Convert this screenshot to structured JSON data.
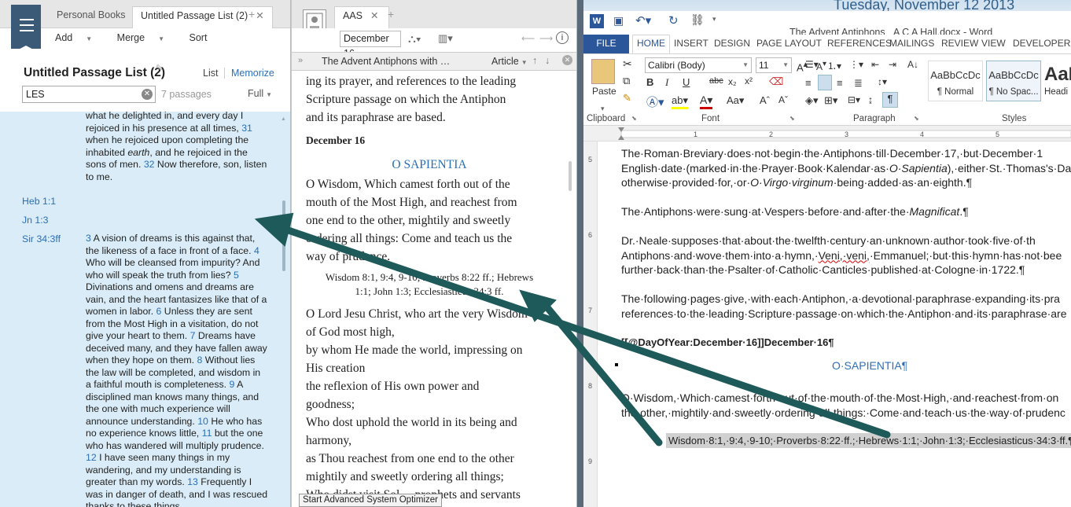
{
  "logos_left": {
    "tabs": [
      "Personal Books",
      "Untitled Passage List (2)"
    ],
    "toolbar": {
      "add": "Add",
      "merge": "Merge",
      "sort": "Sort"
    },
    "title": "Untitled Passage List (2)",
    "view_list": "List",
    "view_memorize": "Memorize",
    "search_value": "LES",
    "passage_count": "7 passages",
    "view_mode": "Full",
    "top_text": [
      "what he delighted in, and every day I",
      "rejoiced in his presence at all times, ",
      "when he rejoiced upon completing the",
      "inhabited ",
      "earth",
      ", and he rejoiced in the",
      "sons of men. ",
      " Now therefore, son, listen",
      "to me."
    ],
    "top_nums": [
      "31",
      "32"
    ],
    "refs": [
      "Heb 1:1",
      "Jn 1:3",
      "Sir 34:3ff"
    ],
    "sir_lines": [
      "A vision of dreams is this against that,",
      "the likeness of a face in front of a face. ",
      "Who will be cleansed from impurity? And",
      "who will speak the truth from lies? ",
      "Divinations and omens and dreams are",
      "vain, and the heart fantasizes like that of a",
      "women in labor. ",
      " Unless they are sent",
      "from the Most High in a visitation, do not",
      "give your heart to them. ",
      " Dreams have",
      "deceived many, and they have fallen away",
      "when they hope on them. ",
      " Without lies",
      "the law will be completed, and wisdom in",
      "a faithful mouth is completeness. ",
      " A",
      "disciplined man knows many things, and",
      "the one with much experience will",
      "announce understanding. ",
      " He who has",
      "no experience knows little, ",
      " but the one",
      "who has wandered will multiply prudence.",
      " I have seen many things in my",
      "wandering, and my understanding is",
      "greater than my words. ",
      " Frequently I",
      "was in danger of death, and I was rescued",
      "thanks to these things."
    ],
    "sir_nums": [
      "3",
      "4",
      "5",
      "6",
      "7",
      "8",
      "9",
      "10",
      "11",
      "12",
      "13"
    ]
  },
  "logos_mid": {
    "tab": "AAS",
    "date": "December 16",
    "resource_title": "The Advent Antiphons with …",
    "article": "Article",
    "text_top": [
      "ing its prayer, and references to the leading",
      "Scripture passage on which the Antiphon",
      "and its paraphrase are based."
    ],
    "date_heading": "December 16",
    "antiphon_title": "O SAPIENTIA",
    "antiphon": [
      "O Wisdom, Which camest forth out of the",
      "mouth of the Most High, and reachest from",
      "one end to the other, mightily and sweetly",
      "ordering all things: Come and teach us the",
      "way of prudence."
    ],
    "citation": [
      "Wisdom 8:1, 9:4, 9-10; Proverbs 8:22 ff.; Hebrews",
      "1:1; John 1:3; Ecclesiasticus 34:3 ff."
    ],
    "prayer": [
      "O Lord Jesu Christ, who art the very Wisdom",
      "of God most high,",
      "by whom He made the world, impressing on",
      "His creation",
      "the reflexion of His own power and",
      "goodness;",
      "Who dost uphold the world in its being and",
      "harmony,",
      "as Thou reachest from one end to the other",
      "mightily and sweetly ordering all things;",
      "Who didst visit Sol… prophets and servants"
    ],
    "tooltip": "Start Advanced System Optimizer"
  },
  "word": {
    "desktop_date": "Tuesday, November 12 2013",
    "title": "The Advent Antiphons _A C A Hall.docx - Word",
    "tabs": [
      "FILE",
      "HOME",
      "INSERT",
      "DESIGN",
      "PAGE LAYOUT",
      "REFERENCES",
      "MAILINGS",
      "REVIEW",
      "VIEW",
      "DEVELOPER"
    ],
    "font_name": "Calibri (Body)",
    "font_size": "11",
    "paste": "Paste",
    "groups": [
      "Clipboard",
      "Font",
      "Paragraph",
      "Styles"
    ],
    "styles": [
      {
        "sample": "AaBbCcDc",
        "name": "¶ Normal"
      },
      {
        "sample": "AaBbCcDc",
        "name": "¶ No Spac..."
      },
      {
        "sample": "AaB",
        "name": "Headi"
      }
    ],
    "doc_lines": {
      "p1": [
        "The·Roman·Breviary·does·not·begin·the·Antiphons·till·December·17,·but·December·1",
        "English·date·(marked·in·the·Prayer·Book·Kalendar·as·",
        "O·Sapientia",
        "),·either·St.·Thomas's·Da",
        "otherwise·provided·for,·or·",
        "O·Virgo·virginum",
        "·being·added·as·an·eighth.¶"
      ],
      "p2": [
        "The·Antiphons·were·sung·at·Vespers·before·and·after·the·",
        "Magnificat",
        ".¶"
      ],
      "p3": [
        "Dr.·Neale·supposes·that·about·the·twelfth·century·an·unknown·author·took·five·of·th",
        "Antiphons·and·wove·them·into·a·hymn,·",
        "Veni,·veni,",
        "·Emmanuel;·but·this·hymn·has·not·bee",
        "further·back·than·the·Psalter·of·Catholic·Canticles·published·at·Cologne·in·1722.¶"
      ],
      "p4": [
        "The·following·pages·give,·with·each·Antiphon,·a·devotional·paraphrase·expanding·its·pra",
        "references·to·the·leading·Scripture·passage·on·which·the·Antiphon·and·its·paraphrase·are"
      ],
      "p5": "[[@DayOfYear:December·16]]December·16¶",
      "sap": "O·SAPIENTIA¶",
      "p6": [
        "O·Wisdom,·Which·camest·forth·out·of·the·mouth·of·the·Most·High,·and·reachest·from·on",
        "the·other,·mightily·and·sweetly·ordering·all·things:·Come·and·teach·us·the·way·of·prudenc"
      ],
      "cit": "Wisdom·8:1,·9:4,·9-10;·Proverbs·8:22·ff.;·Hebrews·1:1;·John·1:3;·Ecclesiasticus·34:3·ff.¶"
    }
  },
  "colors": {
    "logos_accent": "#2a6fb6",
    "passage_bg": "#d9ecf7",
    "word_blue": "#2b579a",
    "arrow": "#1f5a5a"
  }
}
